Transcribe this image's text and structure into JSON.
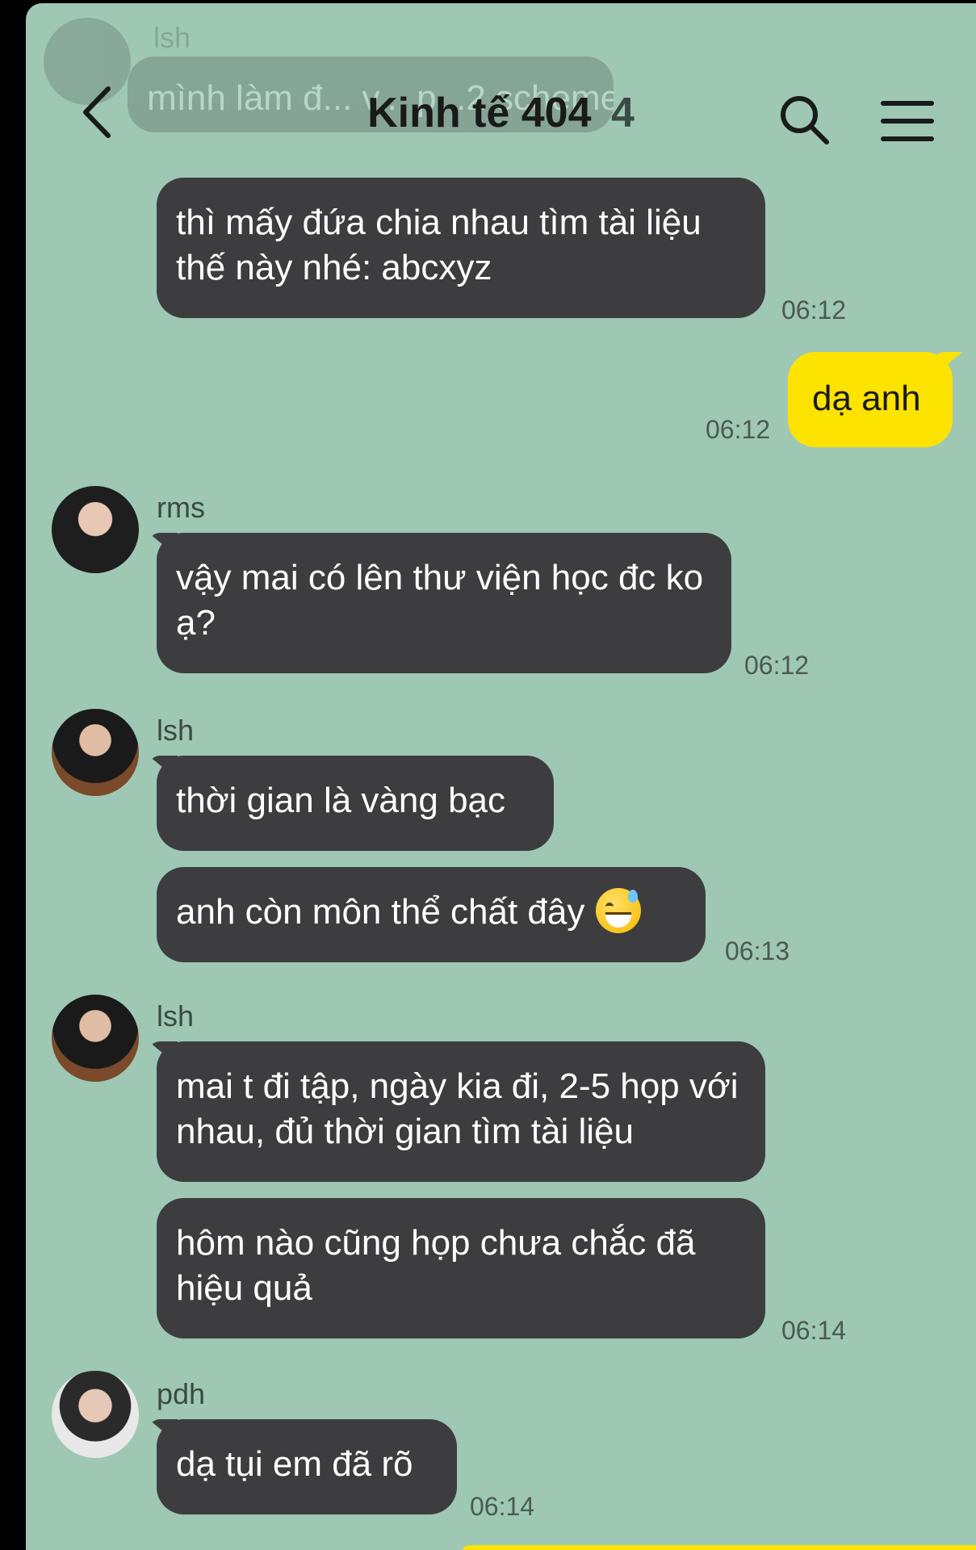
{
  "header": {
    "title": "Kinh tế 404",
    "member_count": "4",
    "back_icon": "chevron-left-icon",
    "search_icon": "search-icon",
    "menu_icon": "menu-icon"
  },
  "faded_message": {
    "sender": "lsh",
    "text": "mình làm đ... v... p...2 scheme"
  },
  "messages": [
    {
      "text": "thì mấy đứa chia nhau tìm tài liệu thế này nhé: abcxyz",
      "time": "06:12"
    },
    {
      "text": "dạ anh",
      "time": "06:12"
    },
    {
      "sender": "rms",
      "text": "vậy mai có lên thư viện học đc ko ạ?",
      "time": "06:12"
    },
    {
      "sender": "lsh",
      "text": "thời gian là vàng bạc"
    },
    {
      "text": "anh còn môn thể chất đây",
      "time": "06:13",
      "emoji": "grinning-sweat-emoji"
    },
    {
      "sender": "lsh",
      "text": "mai t đi tập, ngày kia đi, 2-5 họp với nhau, đủ thời gian tìm tài liệu"
    },
    {
      "text": "hôm nào cũng họp chưa chắc đã hiệu quả",
      "time": "06:14"
    },
    {
      "sender": "pdh",
      "text": "dạ tụi em đã rõ",
      "time": "06:14"
    }
  ],
  "colors": {
    "background": "#9ec8b4",
    "bubble_other": "#3d3d3f",
    "bubble_me": "#fde300"
  }
}
